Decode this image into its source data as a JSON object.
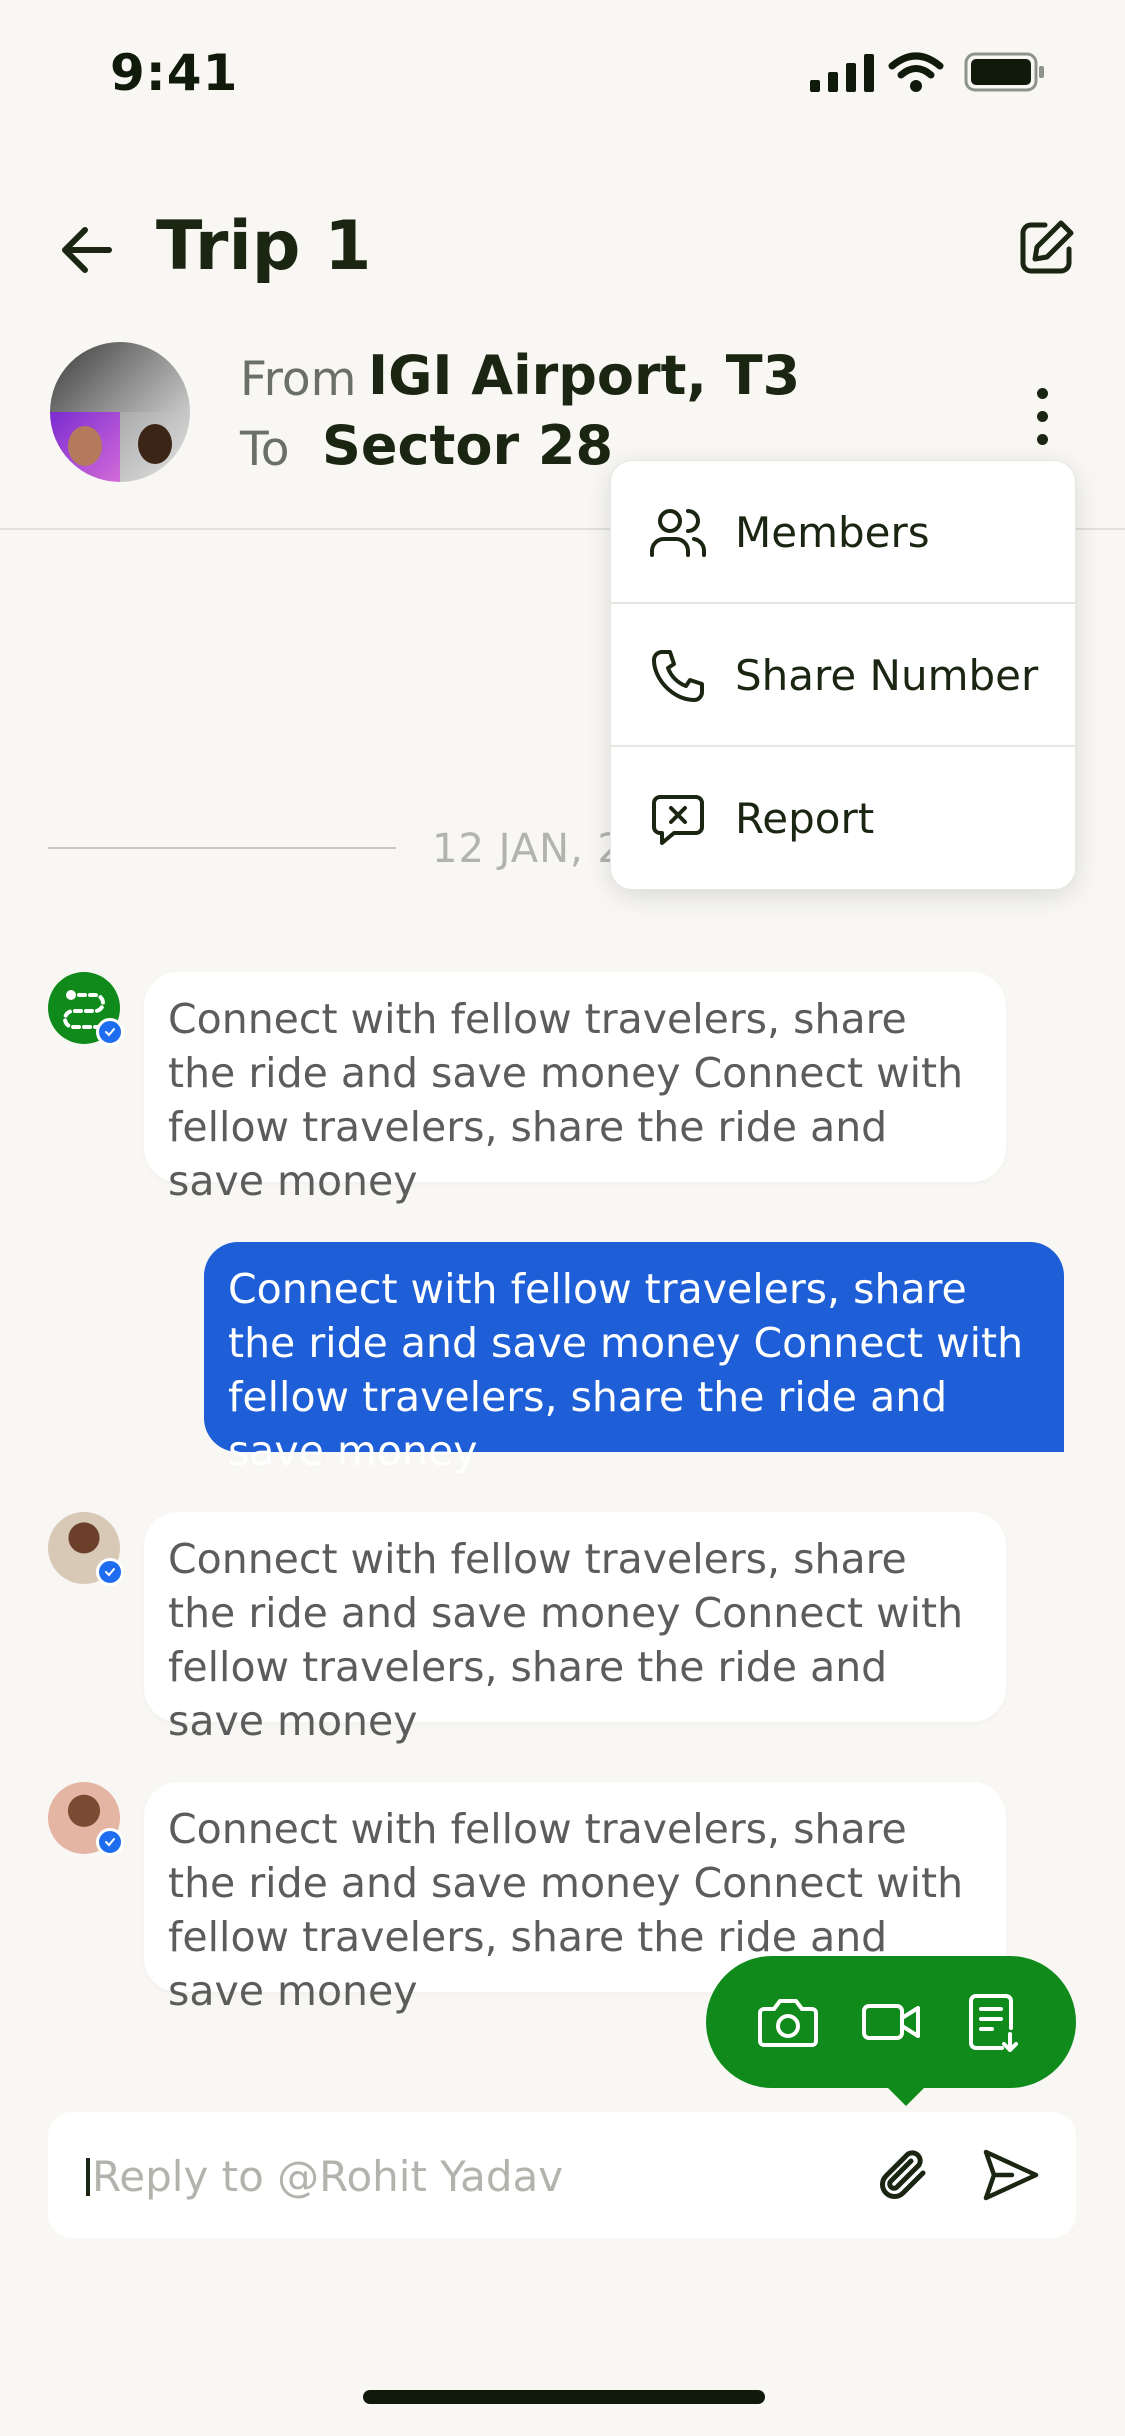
{
  "status_bar": {
    "time": "9:41"
  },
  "header": {
    "title": "Trip 1",
    "route": {
      "from_label": "From",
      "from_value": "IGI Airport, T3",
      "to_label": "To",
      "to_value": "Sector 28"
    }
  },
  "menu": {
    "items": [
      {
        "label": "Members",
        "icon": "users-icon"
      },
      {
        "label": "Share Number",
        "icon": "phone-icon"
      },
      {
        "label": "Report",
        "icon": "report-icon"
      }
    ]
  },
  "chat": {
    "date_separator": "12 JAN, 2",
    "messages": [
      {
        "direction": "incoming",
        "sender": "brand",
        "verified": true,
        "text": "Connect with fellow travelers, share the ride and save money Connect with fellow travelers, share the ride and save money"
      },
      {
        "direction": "outgoing",
        "text": "Connect with fellow travelers, share the ride and save money Connect with fellow travelers, share the ride and save money"
      },
      {
        "direction": "incoming",
        "sender": "user",
        "verified": true,
        "text": "Connect with fellow travelers, share the ride and save money Connect with fellow travelers, share the ride and save money"
      },
      {
        "direction": "incoming",
        "sender": "user",
        "verified": true,
        "text": "Connect with fellow travelers, share the ride and save money Connect with fellow travelers, share the ride and save money"
      }
    ]
  },
  "attachments": {
    "options": [
      "camera-icon",
      "video-icon",
      "document-icon"
    ]
  },
  "composer": {
    "placeholder": "Reply to @Rohit Yadav",
    "value": ""
  },
  "colors": {
    "background": "#f8f7f3",
    "accent_green": "#0f8a1b",
    "outgoing_bubble": "#1e5fd7",
    "verified_badge": "#1e6cf0"
  }
}
